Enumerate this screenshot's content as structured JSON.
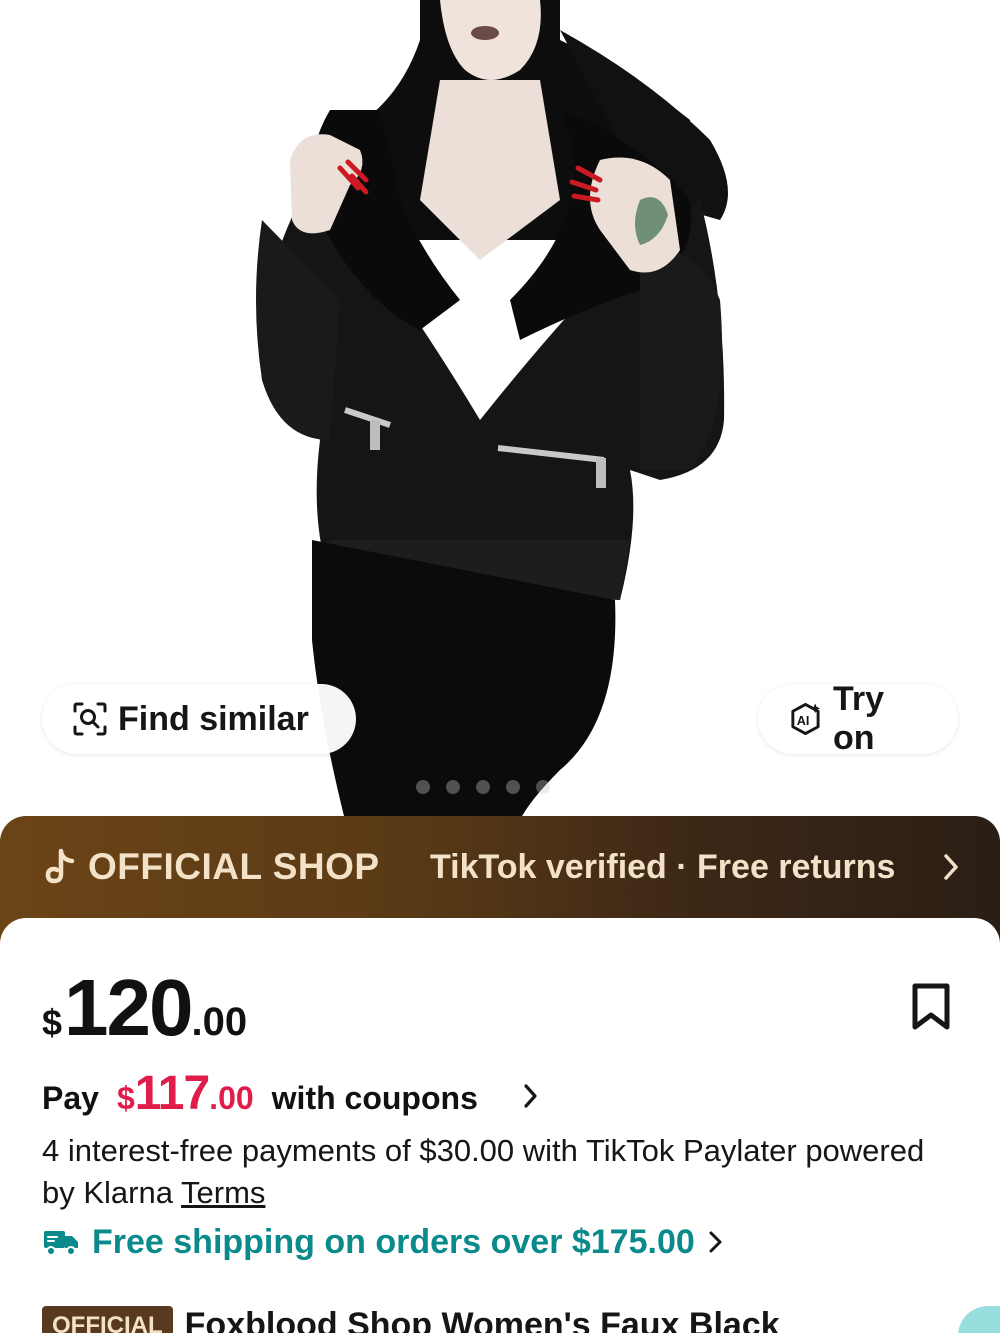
{
  "hero": {
    "find_similar_label": "Find similar",
    "try_on_label": "Try on",
    "carousel": {
      "total": 5,
      "active_index": 4
    }
  },
  "banner": {
    "shop_label": "OFFICIAL SHOP",
    "verified_text": "TikTok verified · Free returns"
  },
  "price": {
    "currency": "$",
    "integer": "120",
    "decimal": ".00"
  },
  "coupon": {
    "prefix": "Pay",
    "currency": "$",
    "integer": "117",
    "decimal": ".00",
    "suffix": "with coupons"
  },
  "klarna": {
    "text": "4 interest-free payments of $30.00 with  TikTok Paylater powered by Klarna",
    "terms_label": "Terms"
  },
  "shipping": {
    "text": "Free shipping on orders over $175.00"
  },
  "product": {
    "badge": "OFFICIAL",
    "title": "Foxblood Shop Women's Faux Black"
  },
  "colors": {
    "banner_start": "#6b4416",
    "banner_end": "#2a1e15",
    "banner_text": "#f3e2c8",
    "coupon_price": "#e01c4b",
    "shipping_text": "#0b8a8c"
  },
  "icons": [
    "image-search-icon",
    "ai-try-on-icon",
    "tiktok-note-icon",
    "chevron-right-icon",
    "bookmark-icon",
    "truck-icon"
  ]
}
